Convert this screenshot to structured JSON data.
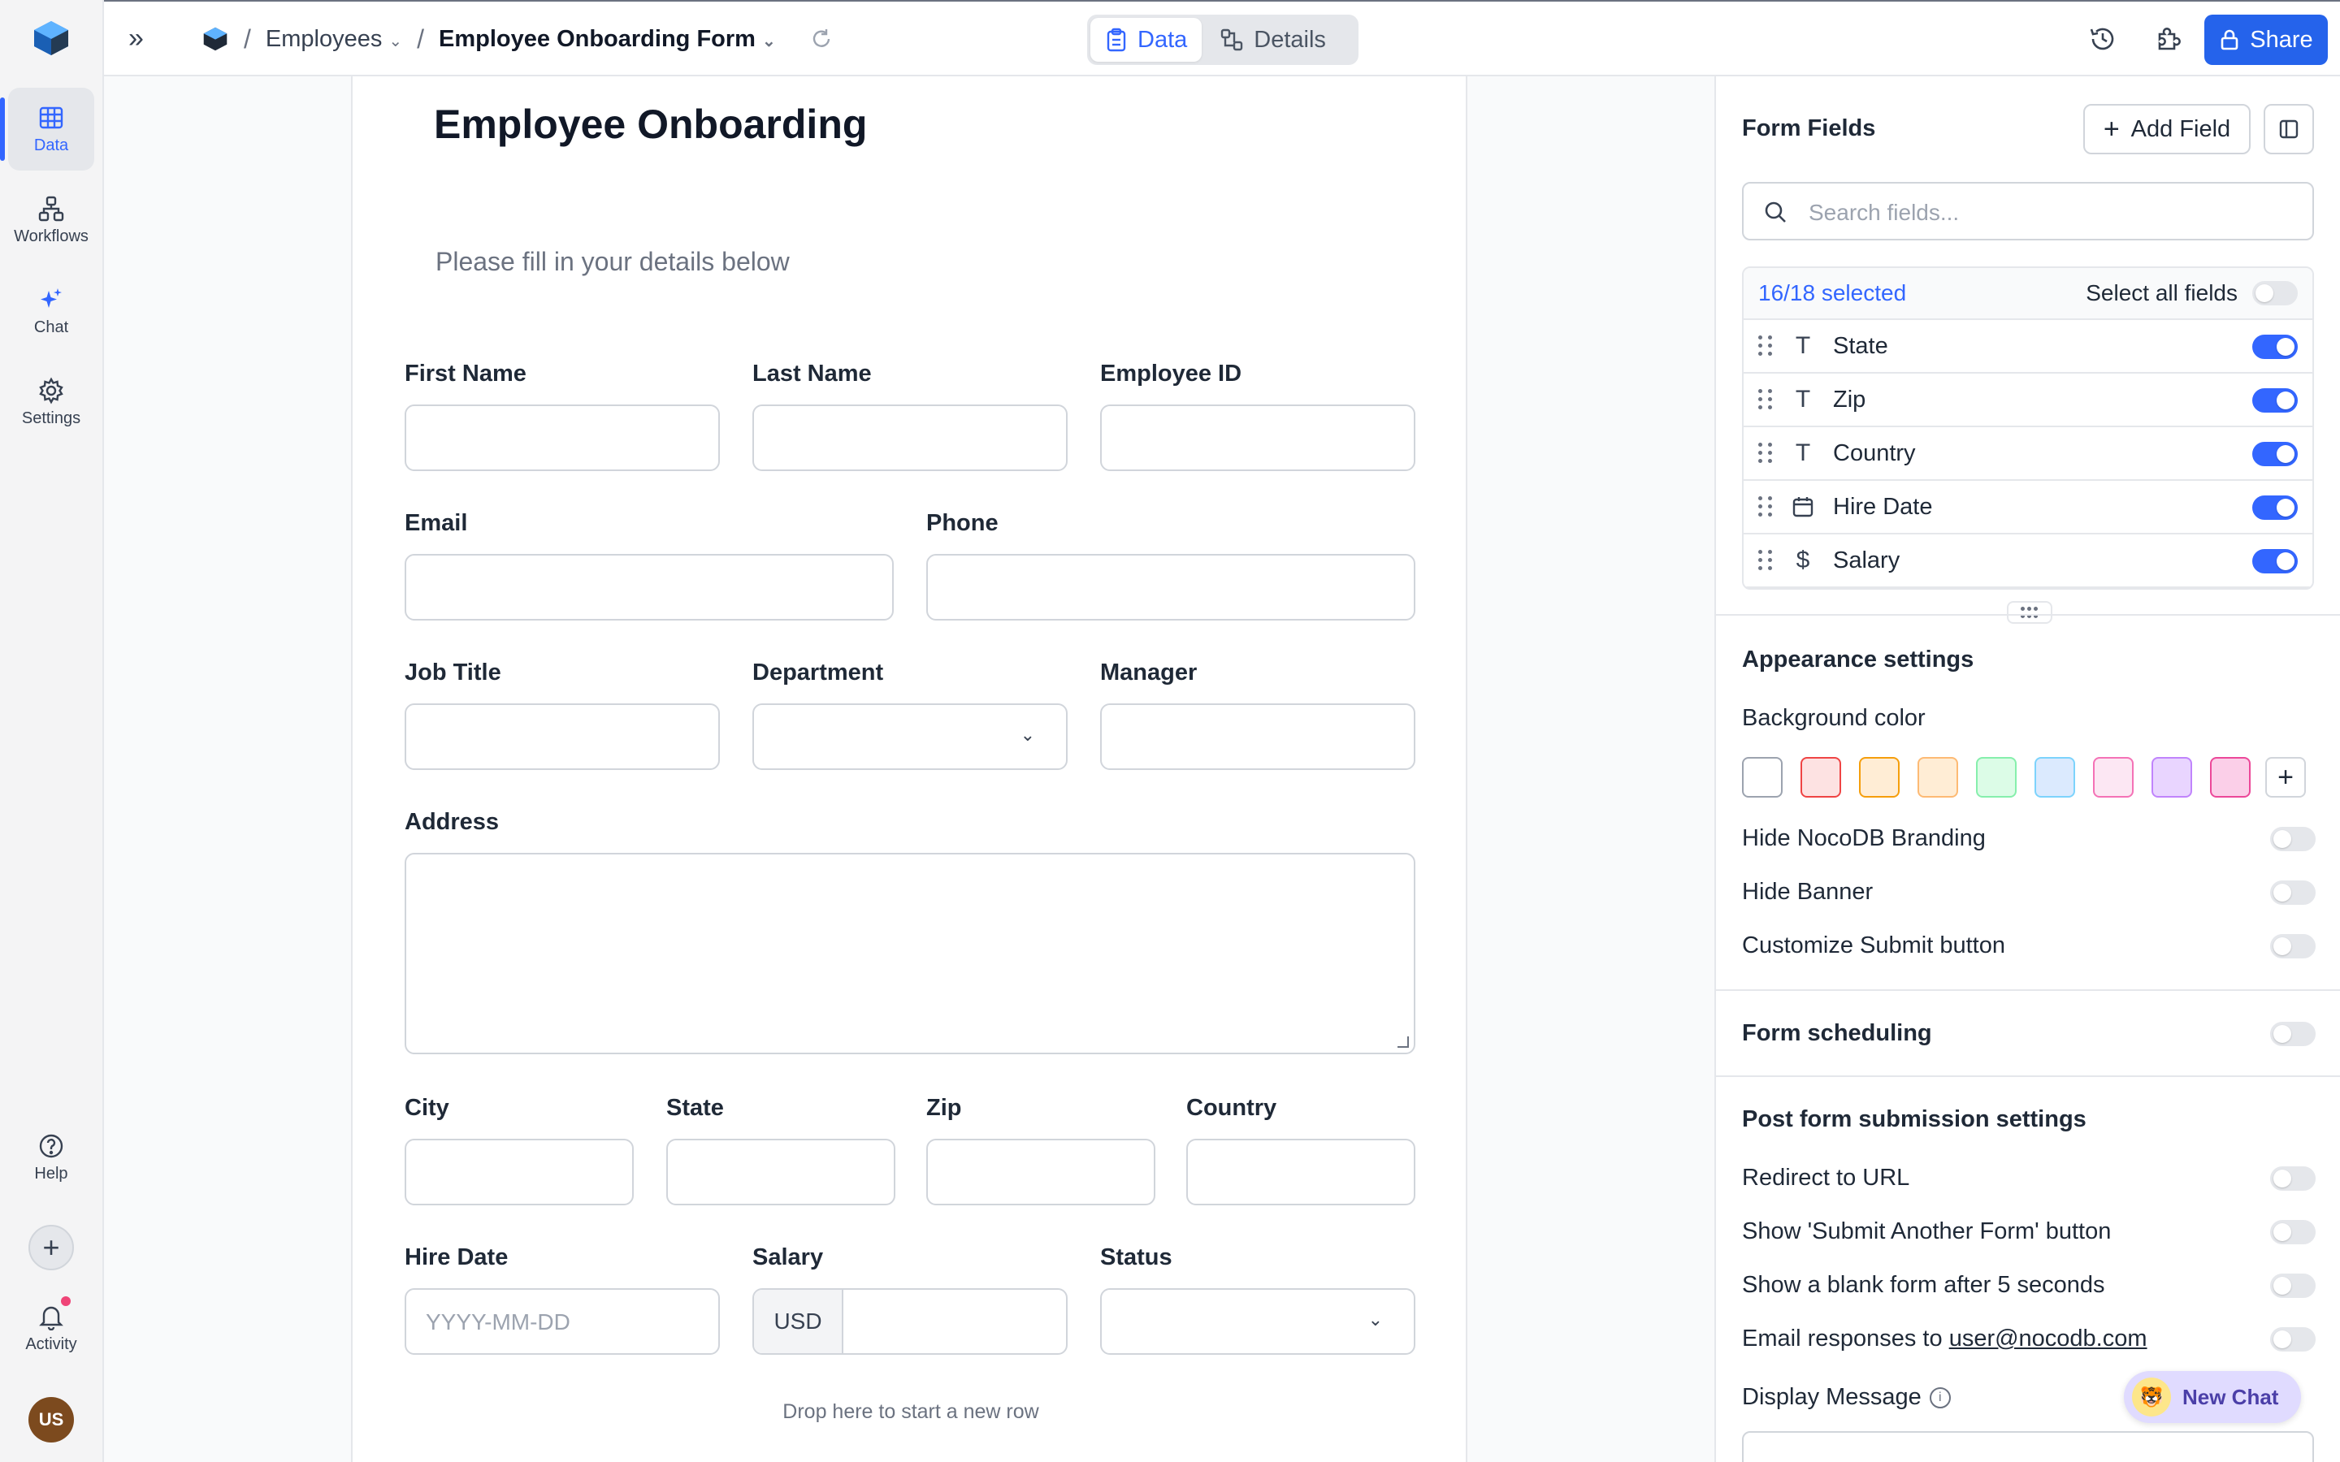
{
  "rail": {
    "items": [
      {
        "label": "Data"
      },
      {
        "label": "Workflows"
      },
      {
        "label": "Chat"
      },
      {
        "label": "Settings"
      }
    ],
    "help_label": "Help",
    "activity_label": "Activity",
    "avatar_initials": "US"
  },
  "topbar": {
    "breadcrumb_table": "Employees",
    "breadcrumb_view": "Employee Onboarding Form",
    "tabs": [
      {
        "label": "Data"
      },
      {
        "label": "Details"
      }
    ],
    "share_label": "Share"
  },
  "form": {
    "title": "Employee Onboarding",
    "subtitle": "Please fill in your details below",
    "fields": {
      "first_name": "First Name",
      "last_name": "Last Name",
      "employee_id": "Employee ID",
      "email": "Email",
      "phone": "Phone",
      "job_title": "Job Title",
      "department": "Department",
      "manager": "Manager",
      "address": "Address",
      "city": "City",
      "state": "State",
      "zip": "Zip",
      "country": "Country",
      "hire_date": "Hire Date",
      "salary": "Salary",
      "status": "Status"
    },
    "hire_date_placeholder": "YYYY-MM-DD",
    "salary_currency": "USD",
    "drop_hint": "Drop here to start a new row"
  },
  "panel": {
    "form_fields_title": "Form Fields",
    "add_field_label": "Add Field",
    "search_placeholder": "Search fields...",
    "selected_count": "16/18 selected",
    "select_all_label": "Select all fields",
    "field_list": [
      {
        "name": "State",
        "icon": "text-icon",
        "enabled": true
      },
      {
        "name": "Zip",
        "icon": "text-icon",
        "enabled": true
      },
      {
        "name": "Country",
        "icon": "text-icon",
        "enabled": true
      },
      {
        "name": "Hire Date",
        "icon": "calendar-icon",
        "enabled": true
      },
      {
        "name": "Salary",
        "icon": "dollar-icon",
        "enabled": true
      }
    ],
    "appearance_title": "Appearance settings",
    "background_color_label": "Background color",
    "swatches": [
      {
        "fill": "#ffffff",
        "border": "#9ca3af"
      },
      {
        "fill": "#fde2e2",
        "border": "#ef4444"
      },
      {
        "fill": "#ffedd5",
        "border": "#f59e0b"
      },
      {
        "fill": "#ffedd5",
        "border": "#fdba74"
      },
      {
        "fill": "#dcfce7",
        "border": "#86efac"
      },
      {
        "fill": "#dbeafe",
        "border": "#7dd3fc"
      },
      {
        "fill": "#fce7f3",
        "border": "#f472b6"
      },
      {
        "fill": "#e9d5ff",
        "border": "#c084fc"
      },
      {
        "fill": "#fbcfe8",
        "border": "#ec4899"
      }
    ],
    "hide_branding_label": "Hide NocoDB Branding",
    "hide_banner_label": "Hide Banner",
    "customize_submit_label": "Customize Submit button",
    "form_scheduling_title": "Form scheduling",
    "post_submission_title": "Post form submission settings",
    "redirect_label": "Redirect to URL",
    "show_submit_another_label": "Show 'Submit Another Form' button",
    "show_blank_label": "Show a blank form after 5 seconds",
    "email_responses_prefix": "Email responses to",
    "email_responses_address": "user@nocodb.com",
    "display_message_label": "Display Message"
  },
  "chat_button": {
    "label": "New Chat"
  },
  "colors": {
    "accent": "#3366ff",
    "share_button": "#2563eb"
  }
}
